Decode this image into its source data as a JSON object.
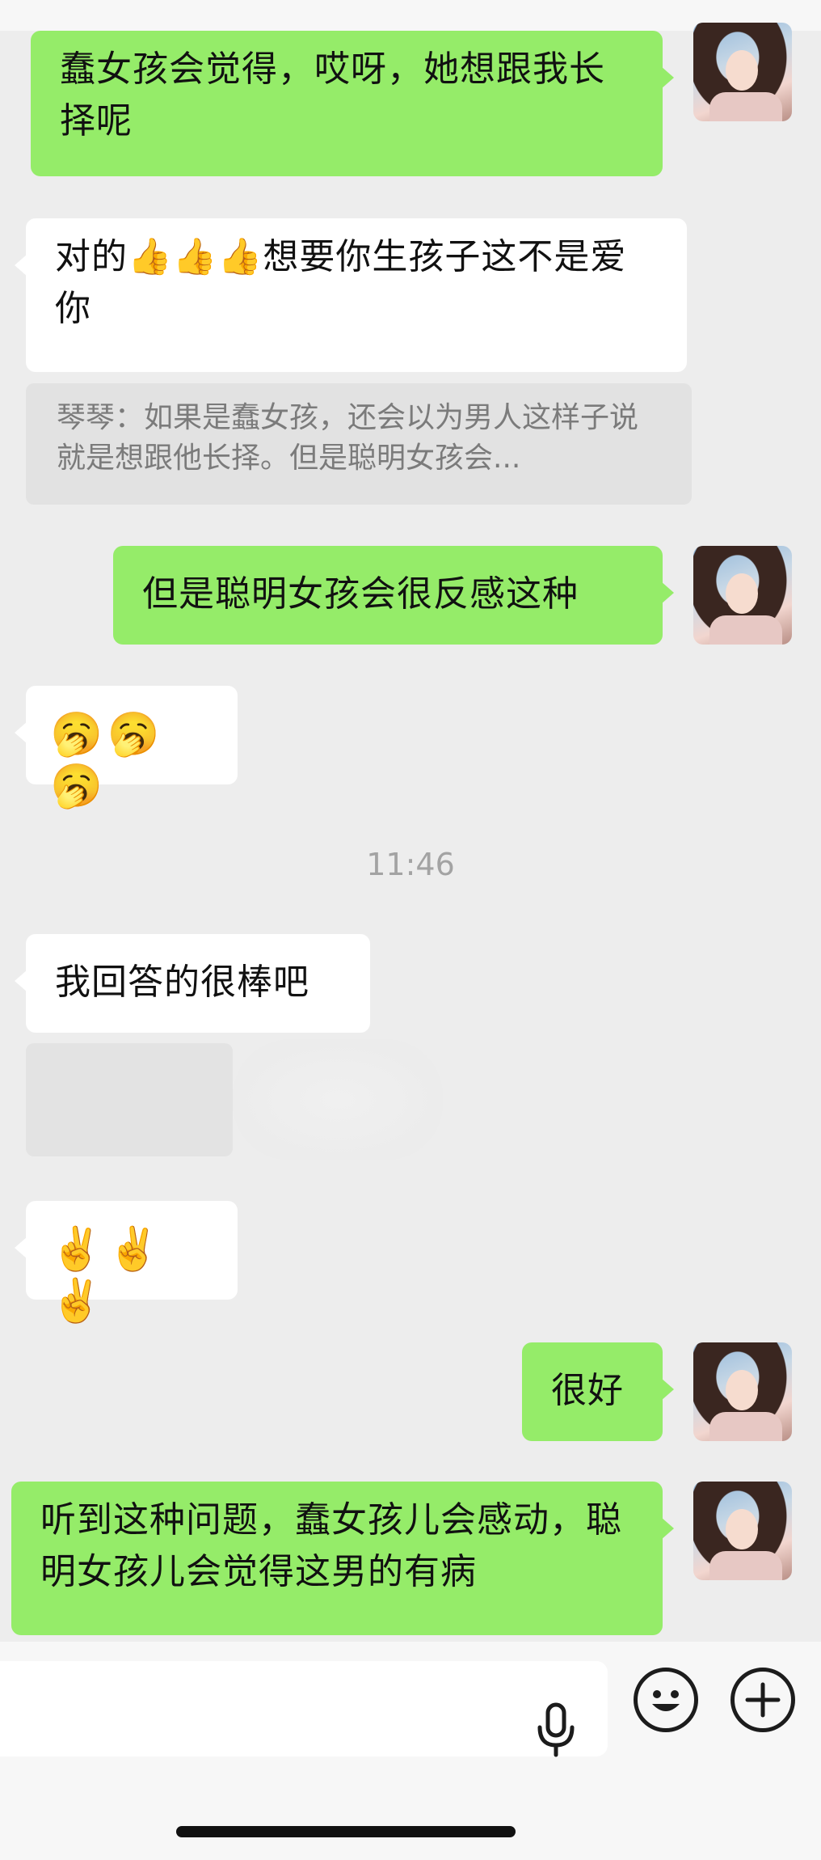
{
  "messages": {
    "m1": {
      "text": "蠢女孩会觉得，哎呀，她想跟我长择呢"
    },
    "m2": {
      "text": "对的👍👍👍想要你生孩子这不是爱你"
    },
    "m2_quote": {
      "text": "琴琴：如果是蠢女孩，还会以为男人这样子说就是想跟他长择。但是聪明女孩会..."
    },
    "m3": {
      "text": "但是聪明女孩会很反感这种"
    },
    "m4": {
      "emoji": "🥱🥱🥱"
    },
    "timestamp": "11:46",
    "m5": {
      "text": "我回答的很棒吧"
    },
    "m6": {
      "emoji": "✌️✌️✌️"
    },
    "m7": {
      "text": "很好"
    },
    "m8": {
      "text": "听到这种问题，蠢女孩儿会感动，聪明女孩儿会觉得这男的有病"
    }
  },
  "icons": {
    "mic": "microphone-icon",
    "emoji": "smiley-icon",
    "plus": "plus-icon"
  },
  "colors": {
    "background": "#ededed",
    "outgoing_bubble": "#95ec69",
    "incoming_bubble": "#ffffff",
    "timestamp": "#a3a3a3"
  }
}
